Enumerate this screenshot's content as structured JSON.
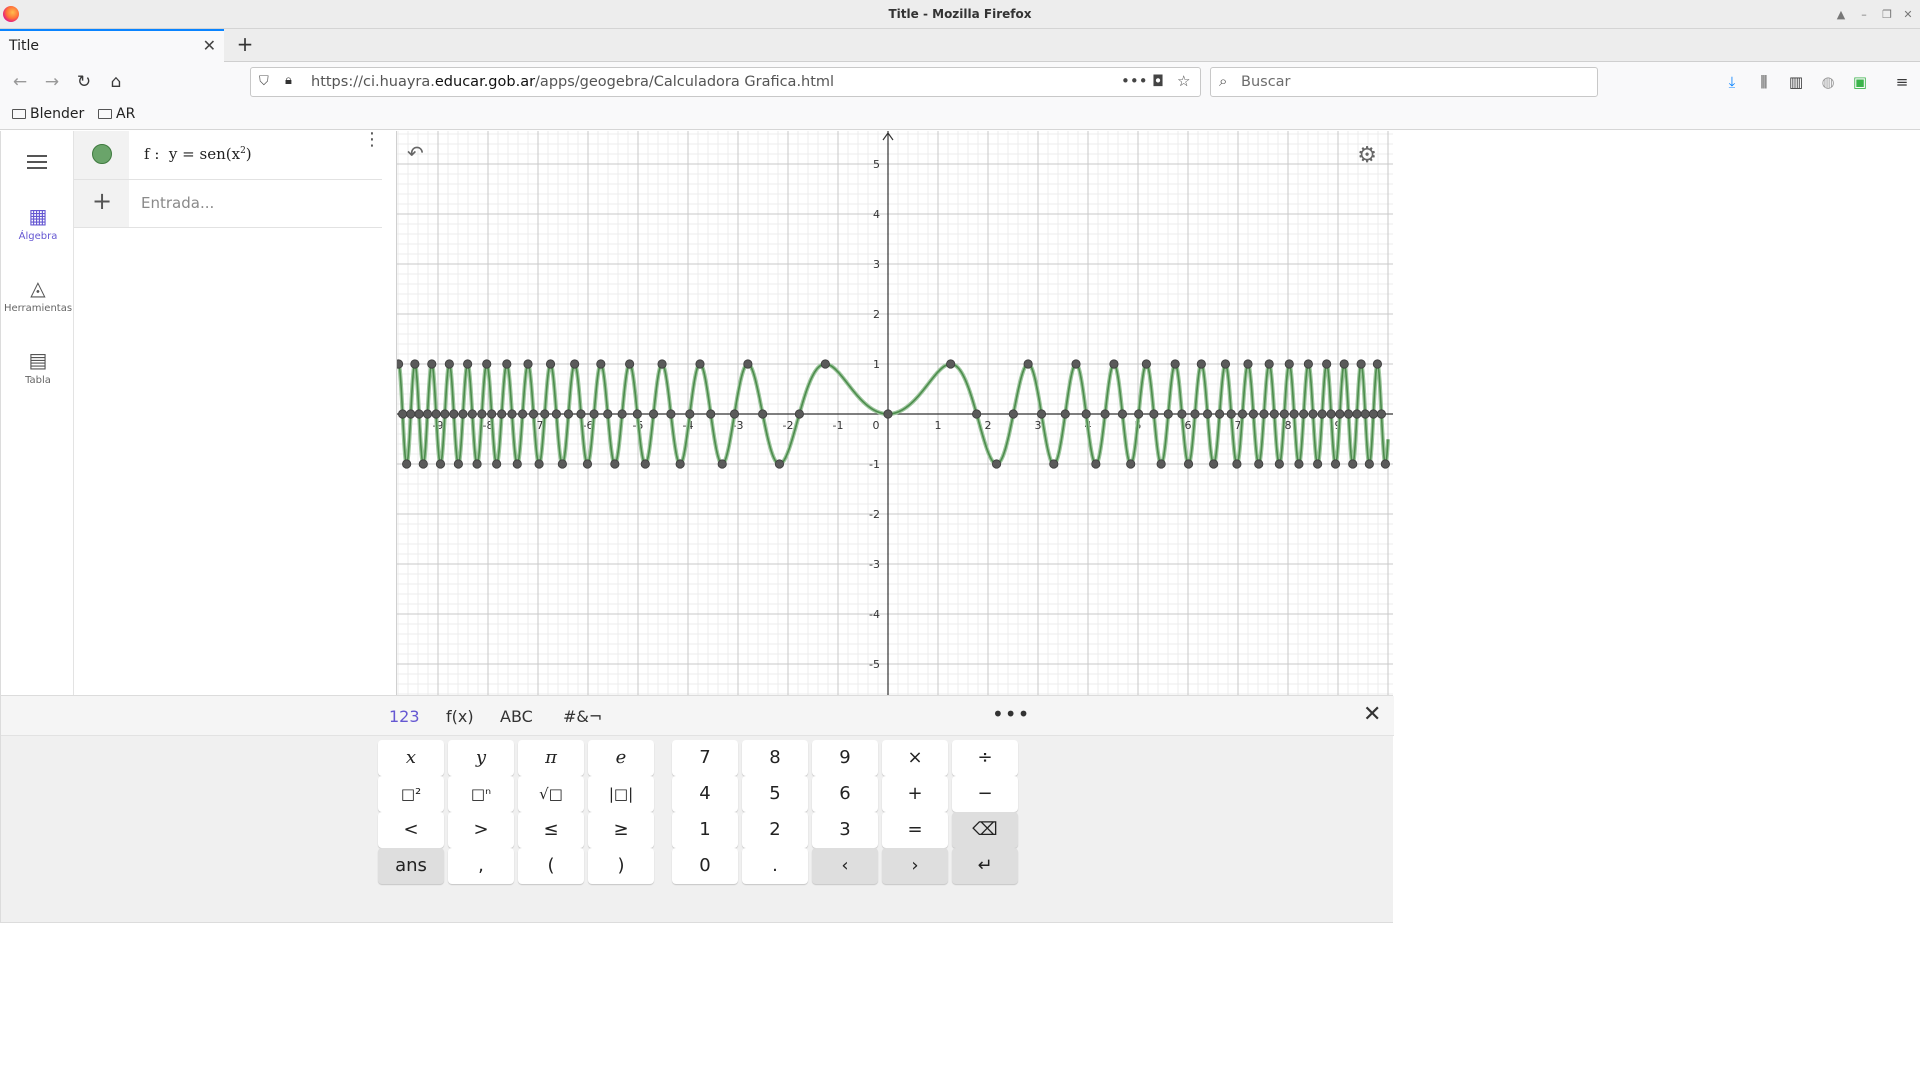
{
  "window": {
    "title": "Title - Mozilla Firefox"
  },
  "tab": {
    "label": "Title",
    "close": "✕",
    "new": "+"
  },
  "urlbar": {
    "url_prefix": "https://ci.huayra.",
    "url_domain": "educar.gob.ar",
    "url_path": "/apps/geogebra/Calculadora Grafica.html",
    "more": "•••"
  },
  "search": {
    "placeholder": "Buscar"
  },
  "bookmarks": [
    {
      "label": "Blender"
    },
    {
      "label": "AR"
    }
  ],
  "sidebar": {
    "items": [
      {
        "label": "Álgebra",
        "icon": "calculator-icon"
      },
      {
        "label": "Herramientas",
        "icon": "tools-icon"
      },
      {
        "label": "Tabla",
        "icon": "table-icon"
      }
    ]
  },
  "algebra": {
    "formula_name": "f :",
    "formula_eq": "y = sen(x",
    "formula_exp": "2",
    "formula_close": ")",
    "input_placeholder": "Entrada..."
  },
  "chart_data": {
    "type": "line",
    "function": "y = sen(x^2)",
    "xlim": [
      -9.8,
      10
    ],
    "ylim": [
      -5.5,
      5.6
    ],
    "x_ticks": [
      -9,
      -8,
      -7,
      -6,
      -5,
      -4,
      -3,
      -2,
      -1,
      0,
      1,
      2,
      3,
      4,
      5,
      6,
      7,
      8,
      9
    ],
    "y_ticks": [
      -5,
      -4,
      -3,
      -2,
      -1,
      1,
      2,
      3,
      4,
      5
    ],
    "grid": true,
    "curve_color": "#4c8c4c",
    "point_color": "#5a5a5a",
    "special_points": "extrema and zeros of f"
  },
  "keyboard": {
    "tabs": [
      "123",
      "f(x)",
      "ABC",
      "#&¬"
    ],
    "more": "•••",
    "close": "✕",
    "left_rows": [
      [
        "x",
        "y",
        "π",
        "e"
      ],
      [
        "□²",
        "□ⁿ",
        "√□",
        "|□|"
      ],
      [
        "<",
        ">",
        "≤",
        "≥"
      ],
      [
        "ans",
        ",",
        "(",
        ")"
      ]
    ],
    "right_rows": [
      [
        "7",
        "8",
        "9",
        "×",
        "÷"
      ],
      [
        "4",
        "5",
        "6",
        "+",
        "−"
      ],
      [
        "1",
        "2",
        "3",
        "=",
        "⌫"
      ],
      [
        "0",
        ".",
        "‹",
        "›",
        "↵"
      ]
    ]
  }
}
